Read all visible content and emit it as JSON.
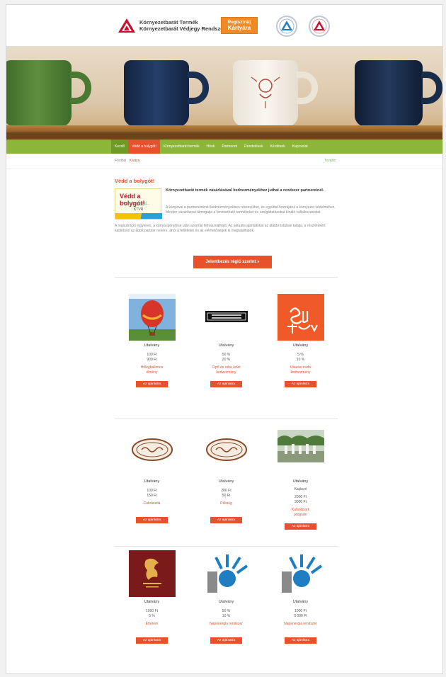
{
  "header": {
    "logo_line1": "Környezetbarát Termék",
    "logo_line2": "Környezetbarát Védjegy Rendszer",
    "register_line1": "Regisztrálj",
    "register_line2": "Kártyára"
  },
  "colors": {
    "accent": "#e8502e",
    "nav_green": "#8bb63a",
    "orange": "#f08a24"
  },
  "nav": {
    "items": [
      "Kezdő",
      "Védd a bolygót!",
      "Környezetbarát termék",
      "Hírek",
      "Partnerek",
      "Rendelések",
      "Kérdések",
      "Kapcsolat"
    ]
  },
  "breadcrumb": {
    "home": "Főoldal",
    "current": "Kártya"
  },
  "sidelink": "Tovább",
  "content": {
    "title": "Védd a bolygót!",
    "promo": {
      "line1": "Védd a bolygót!",
      "line2": "Környezetbarát...",
      "line3": "KTVR"
    },
    "intro_lead": "Környezetbarát termék vásárlásával kedvezményekhez juthat a rendszer partnereinél.",
    "intro_text": "A kártyával a partnereinknél kedvezményekben részesülhet, és egyúttal hozzájárul a környezet védelméhez. Minden vásárlással támogatja a fenntartható termékeket és szolgáltatásokat kínáló vállalkozásokat.",
    "intro_text2": "A regisztráció ingyenes, a kártya igénylése után azonnal felhasználható. Az aktuális ajánlatokat az alábbi listában találja, a részletekért kattintson az adott partner nevére, ahol a feltételek és az elérhetőségek is megtalálhatók.",
    "cta": "Jelentkezés régió szerint »"
  },
  "offers": [
    {
      "name": "Utalvány",
      "city": "",
      "price1": "100 Ft",
      "price2": "900 Ft",
      "desc1": "Hőlégballonos",
      "desc2": "élmény",
      "more": "Az ajánlatra"
    },
    {
      "name": "Utalvány",
      "city": "",
      "price1": "50 %",
      "price2": "20 %",
      "desc1": "Cipő és ruha üzlet",
      "desc2": "kedvezmény",
      "more": "Az ajánlatra"
    },
    {
      "name": "Utalvány",
      "city": "",
      "price1": "5 %",
      "price2": "10 %",
      "desc1": "Utazási iroda",
      "desc2": "kedvezmény",
      "more": "Az ajánlatra"
    },
    {
      "name": "Utalvány",
      "city": "",
      "price1": "100 Ft",
      "price2": "150 Ft",
      "desc1": "Cukrászda",
      "desc2": "",
      "more": "Az ajánlatra"
    },
    {
      "name": "Utalvány",
      "city": "",
      "price1": "200 Ft",
      "price2": "50 Ft",
      "desc1": "Pékség",
      "desc2": "",
      "more": "Az ajánlatra"
    },
    {
      "name": "Utalvány",
      "city": "Kajászó",
      "price1": "2000 Ft",
      "price2": "3000 Ft",
      "desc1": "Kalandpark",
      "desc2": "program",
      "more": "Az ajánlatra"
    },
    {
      "name": "Utalvány",
      "city": "",
      "price1": "1000 Ft",
      "price2": "5 %",
      "desc1": "Étterem",
      "desc2": "",
      "more": "Az ajánlatra"
    },
    {
      "name": "Utalvány",
      "city": "",
      "price1": "50 %",
      "price2": "10 %",
      "desc1": "Napenergia rendszer",
      "desc2": "",
      "more": "Az ajánlatra"
    },
    {
      "name": "Utalvány",
      "city": "",
      "price1": "1000 Ft",
      "price2": "5 000 Ft",
      "desc1": "Napenergia rendszer",
      "desc2": "",
      "more": "Az ajánlatra"
    }
  ]
}
